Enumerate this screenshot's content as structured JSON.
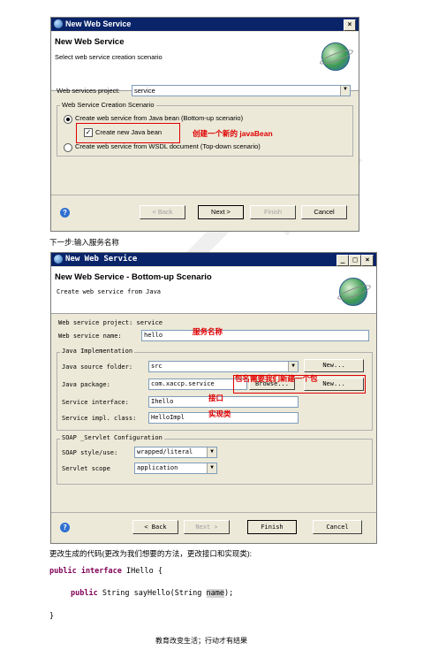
{
  "wizard1": {
    "title": "New Web Service",
    "close_label": "×",
    "header_title": "New Web Service",
    "header_subtitle": "Select web service creation scenario",
    "project_label": "Web services project:",
    "project_value": "service",
    "group_label": "Web Service Creation Scenario",
    "radio_bottom_up": "Create web service from Java bean (Bottom-up scenario)",
    "checkbox_label": "Create new Java bean",
    "radio_top_down": "Create web service from WSDL document (Top-down scenario)",
    "annotation": "创建一个新的 javaBean",
    "buttons": {
      "help": "?",
      "back": "< Back",
      "next": "Next >",
      "finish": "Finish",
      "cancel": "Cancel"
    }
  },
  "caption1": "下一步:输入服务名称",
  "wizard2": {
    "title": "New Web Service",
    "controls": [
      "_",
      "□",
      "×"
    ],
    "header_title": "New Web Service - Bottom-up Scenario",
    "header_subtitle": "Create web service from Java",
    "project_line": "Web service project: service",
    "name_label": "Web service name:",
    "name_value": "hello",
    "name_annotation": "服务名称",
    "impl_group": "Java Implementation",
    "source_folder_label": "Java source folder:",
    "source_folder_value": "src",
    "new_label": "New...",
    "package_label": "Java package:",
    "package_value": "com.xaccp.service",
    "browse_label": "Browse...",
    "package_annotation": "包名需要我们新建一个包",
    "interface_label": "Service interface:",
    "interface_value": "Ihello",
    "interface_annotation": "接口",
    "impl_label": "Service impl. class:",
    "impl_value": "HelloImpl",
    "impl_annotation": "实现类",
    "soap_group": "SOAP _Servlet Configuration",
    "style_label": "SOAP style/use:",
    "style_value": "wrapped/literal",
    "scope_label": "Servlet scope",
    "scope_value": "application",
    "buttons": {
      "help": "?",
      "back": "< Back",
      "next": "Next >",
      "finish": "Finish",
      "cancel": "Cancel"
    }
  },
  "caption2": "更改生成的代码(更改为我们想要的方法，更改接口和实现类):",
  "code": {
    "line1_kw": "public interface",
    "line1_rest": " IHello {",
    "line2_kw": "public",
    "line2_mid": " String sayHello(String ",
    "line2_param": "name",
    "line2_end": ");",
    "line3": "}"
  },
  "footer": "教育改变生活；行动才有结果"
}
